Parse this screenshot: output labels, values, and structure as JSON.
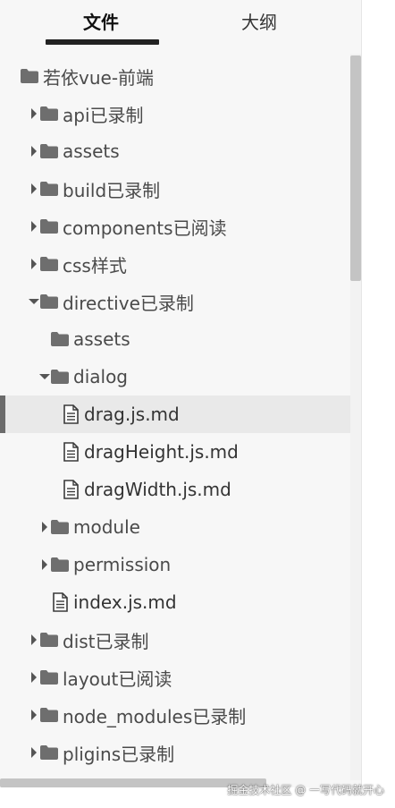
{
  "tabs": {
    "files_label": "文件",
    "outline_label": "大纲"
  },
  "tree": [
    {
      "label": "若依vue-前端",
      "type": "folder",
      "depth": 0,
      "arrow": "none",
      "selected": false
    },
    {
      "label": "api已录制",
      "type": "folder",
      "depth": 1,
      "arrow": "right",
      "selected": false
    },
    {
      "label": "assets",
      "type": "folder",
      "depth": 1,
      "arrow": "right",
      "selected": false
    },
    {
      "label": "build已录制",
      "type": "folder",
      "depth": 1,
      "arrow": "right",
      "selected": false
    },
    {
      "label": "components已阅读",
      "type": "folder",
      "depth": 1,
      "arrow": "right",
      "selected": false
    },
    {
      "label": "css样式",
      "type": "folder",
      "depth": 1,
      "arrow": "right",
      "selected": false
    },
    {
      "label": "directive已录制",
      "type": "folder",
      "depth": 1,
      "arrow": "down",
      "selected": false
    },
    {
      "label": "assets",
      "type": "folder",
      "depth": 2,
      "arrow": "none",
      "selected": false
    },
    {
      "label": "dialog",
      "type": "folder",
      "depth": 2,
      "arrow": "down",
      "selected": false
    },
    {
      "label": "drag.js.md",
      "type": "file",
      "depth": 3,
      "arrow": "none",
      "selected": true
    },
    {
      "label": "dragHeight.js.md",
      "type": "file",
      "depth": 3,
      "arrow": "none",
      "selected": false
    },
    {
      "label": "dragWidth.js.md",
      "type": "file",
      "depth": 3,
      "arrow": "none",
      "selected": false
    },
    {
      "label": "module",
      "type": "folder",
      "depth": 2,
      "arrow": "right",
      "selected": false
    },
    {
      "label": "permission",
      "type": "folder",
      "depth": 2,
      "arrow": "right",
      "selected": false
    },
    {
      "label": "index.js.md",
      "type": "file",
      "depth": 2,
      "arrow": "none",
      "selected": false
    },
    {
      "label": "dist已录制",
      "type": "folder",
      "depth": 1,
      "arrow": "right",
      "selected": false
    },
    {
      "label": "layout已阅读",
      "type": "folder",
      "depth": 1,
      "arrow": "right",
      "selected": false
    },
    {
      "label": "node_modules已录制",
      "type": "folder",
      "depth": 1,
      "arrow": "right",
      "selected": false
    },
    {
      "label": "pligins已录制",
      "type": "folder",
      "depth": 1,
      "arrow": "right",
      "selected": false
    }
  ],
  "watermark": "掘金技术社区 @ 一写代码就开心",
  "colors": {
    "background": "#f7f7f7",
    "text": "#4a4a4a",
    "folder_icon": "#6e6e6e",
    "selection": "#e9e9e9",
    "selection_marker": "#6b6b6b",
    "scrollbar_thumb": "#c4c4c4"
  },
  "icons": {
    "folder": "folder-icon",
    "file": "document-icon",
    "collapsed": "chevron-right-icon",
    "expanded": "chevron-down-icon"
  }
}
